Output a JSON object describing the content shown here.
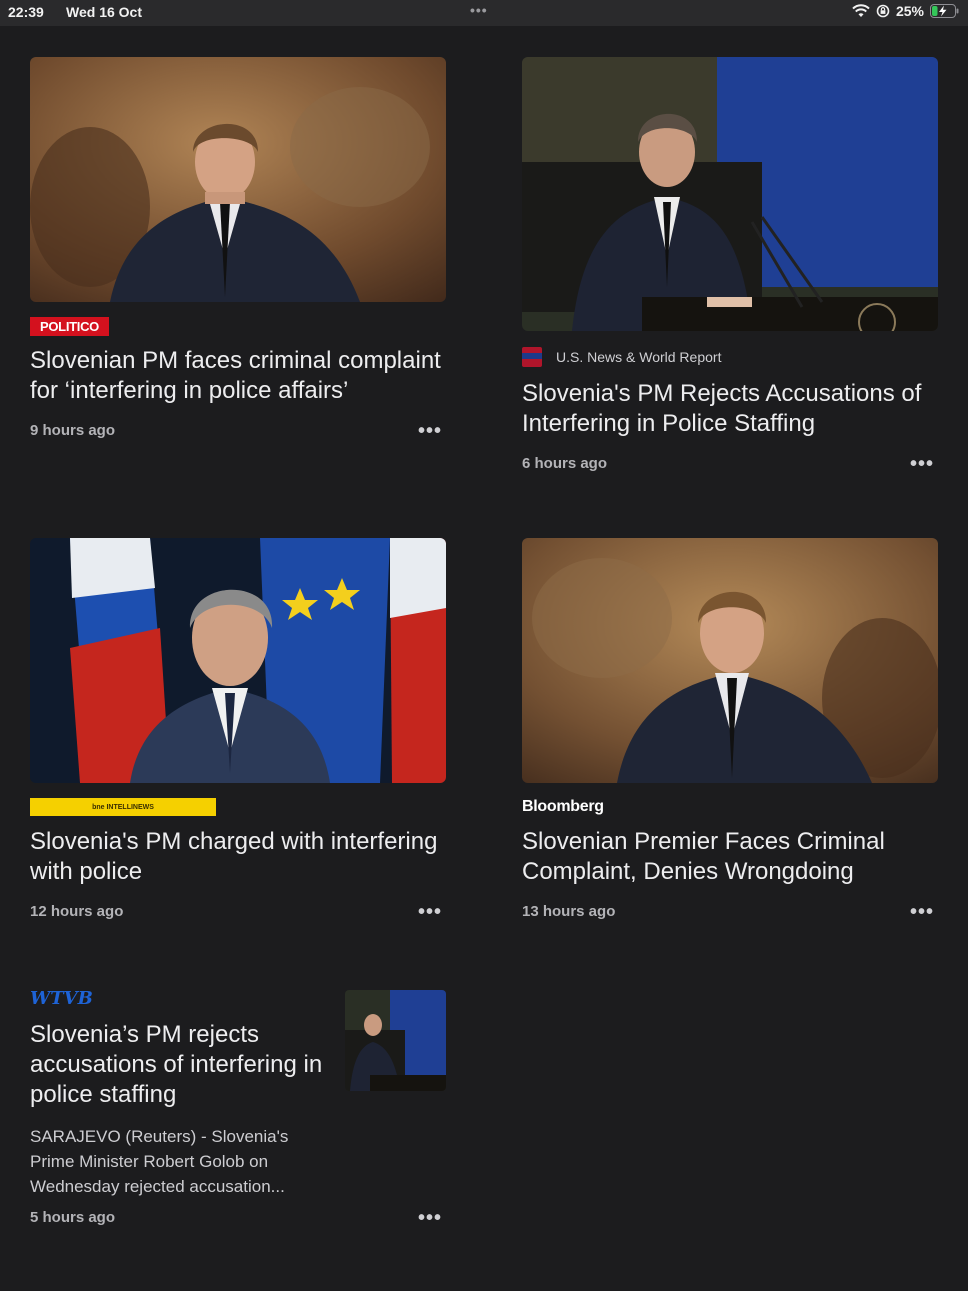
{
  "status_bar": {
    "time": "22:39",
    "date": "Wed 16 Oct",
    "multitask_dots": "•••",
    "battery_percent": "25%",
    "battery_level": 0.25,
    "charging": true
  },
  "articles": [
    {
      "source": "POLITICO",
      "title": "Slovenian PM faces criminal complaint for ‘interfering in police affairs’",
      "time": "9 hours ago",
      "more": "•••"
    },
    {
      "source": "U.S. News & World Report",
      "title": "Slovenia's PM Rejects Accusations of Interfering in Police Staffing",
      "time": "6 hours ago",
      "more": "•••"
    },
    {
      "source": "bne INTELLINEWS",
      "title": "Slovenia's PM charged with interfering with police",
      "time": "12 hours ago",
      "more": "•••"
    },
    {
      "source": "Bloomberg",
      "title": "Slovenian Premier Faces Criminal Complaint, Denies Wrongdoing",
      "time": "13 hours ago",
      "more": "•••"
    },
    {
      "source": "WTVB",
      "title": "Slovenia’s PM rejects accusations of interfering in police staffing",
      "excerpt": "SARAJEVO (Reuters) - Slovenia's Prime Minister Robert Golob on Wednesday rejected accusation...",
      "time": "5 hours ago",
      "more": "•••"
    }
  ],
  "colors": {
    "background": "#1c1c1e",
    "politico_red": "#d4111e",
    "bne_yellow": "#f5d000",
    "wtvb_blue": "#1e63d6"
  }
}
